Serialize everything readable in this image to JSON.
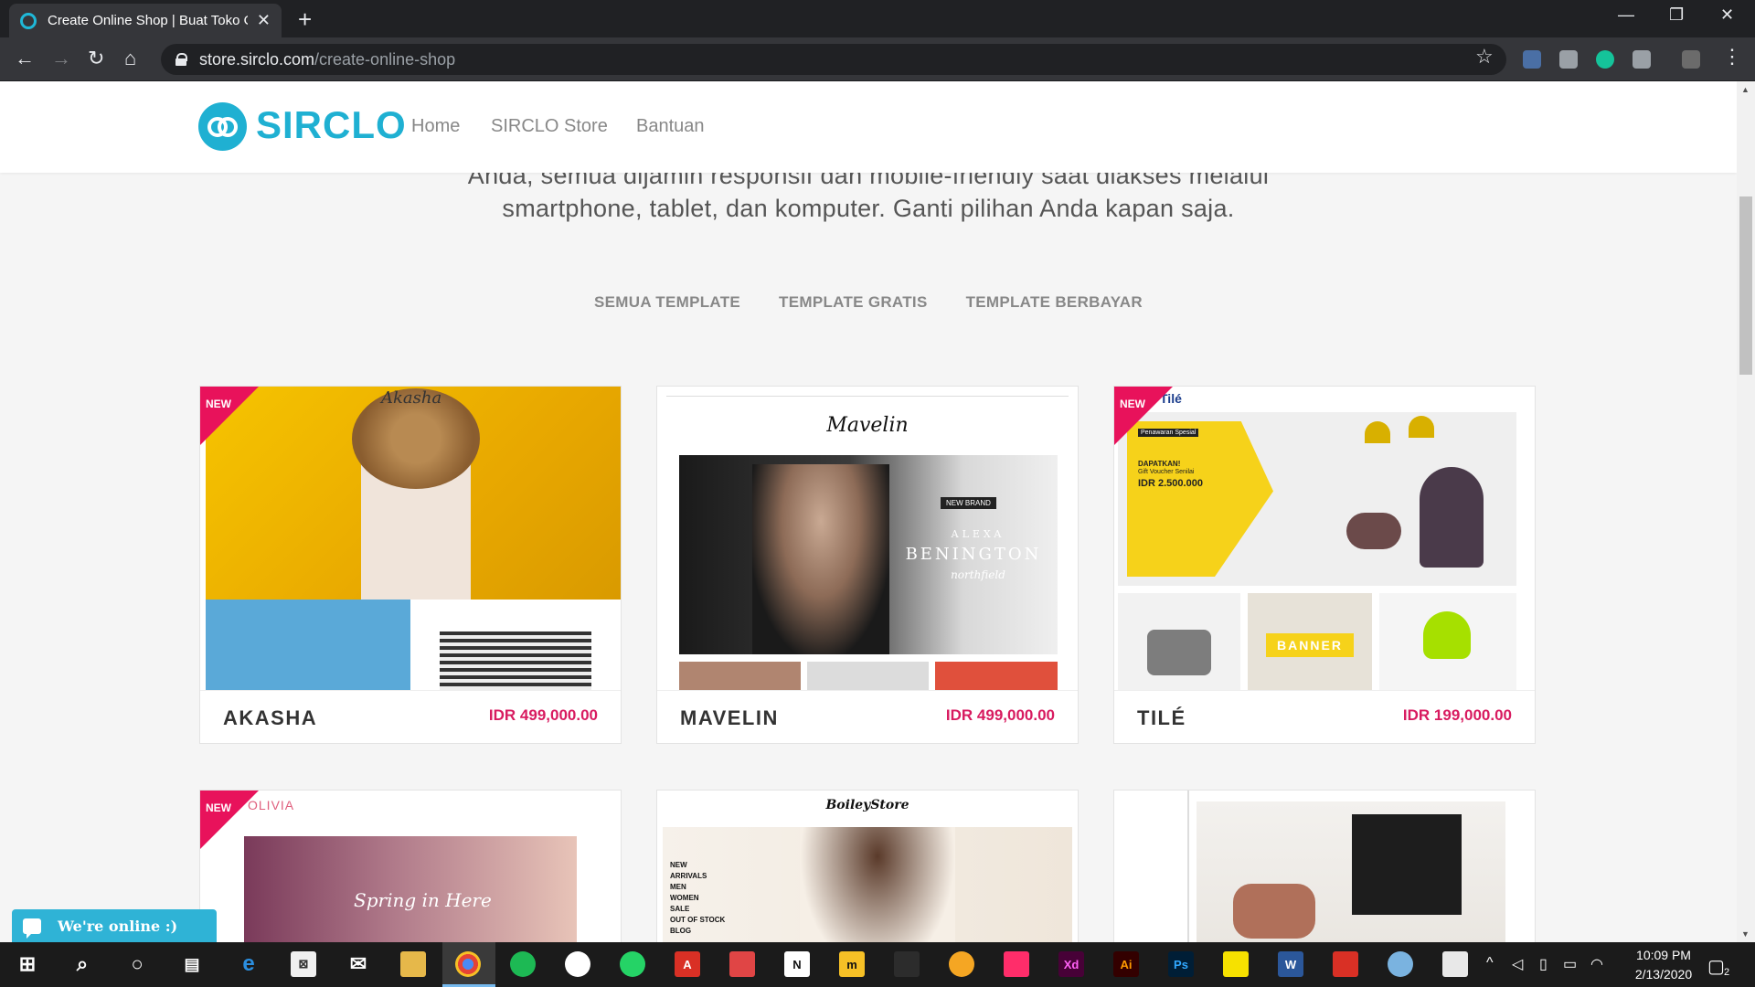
{
  "browser": {
    "tab_title": "Create Online Shop | Buat Toko O",
    "url_host": "store.sirclo.com",
    "url_path": "/create-online-shop"
  },
  "header": {
    "logo_text": "SIRCLO",
    "nav": [
      "Home",
      "SIRCLO Store",
      "Bantuan"
    ]
  },
  "intro": {
    "line1": "Anda, semua dijamin responsif dan mobile-friendly saat diakses melalui",
    "line2": "smartphone, tablet, dan komputer. Ganti pilihan Anda kapan saja."
  },
  "filters": [
    "SEMUA TEMPLATE",
    "TEMPLATE GRATIS",
    "TEMPLATE BERBAYAR"
  ],
  "templates": [
    {
      "name": "AKASHA",
      "price": "IDR 499,000.00",
      "badge": "NEW",
      "thumb_label": "Akasha"
    },
    {
      "name": "MAVELIN",
      "price": "IDR 499,000.00",
      "badge": "",
      "thumb_label": "Mavelin"
    },
    {
      "name": "TILÉ",
      "price": "IDR 199,000.00",
      "badge": "NEW",
      "thumb_label": "Tilé"
    },
    {
      "name": "",
      "price": "",
      "badge": "NEW",
      "thumb_label": "OLIVIA"
    },
    {
      "name": "",
      "price": "",
      "badge": "",
      "thumb_label": "BoileyStore"
    },
    {
      "name": "",
      "price": "",
      "badge": "",
      "thumb_label": ""
    }
  ],
  "mavelin_banner": {
    "tag": "NEW BRAND",
    "line1": "ALEXA",
    "line2": "BENINGTON",
    "line3": "northfield"
  },
  "tile_banner": {
    "line1": "Penawaran Spesial",
    "line2": "DAPATKAN!",
    "line3": "Gift Voucher Senilai",
    "line4": "IDR 2.500.000",
    "banner": "BANNER"
  },
  "olivia_banner": "Spring in Here",
  "boiley_menu": [
    "NEW",
    "ARRIVALS",
    "MEN",
    "WOMEN",
    "SALE",
    "OUT OF STOCK",
    "BLOG"
  ],
  "chat": {
    "label": "We're online :)"
  },
  "taskbar": {
    "time": "10:09 PM",
    "date": "2/13/2020",
    "notif_count": "2"
  },
  "colors": {
    "brand": "#1fb0d2",
    "price": "#d81b60",
    "badge": "#e8125b"
  }
}
